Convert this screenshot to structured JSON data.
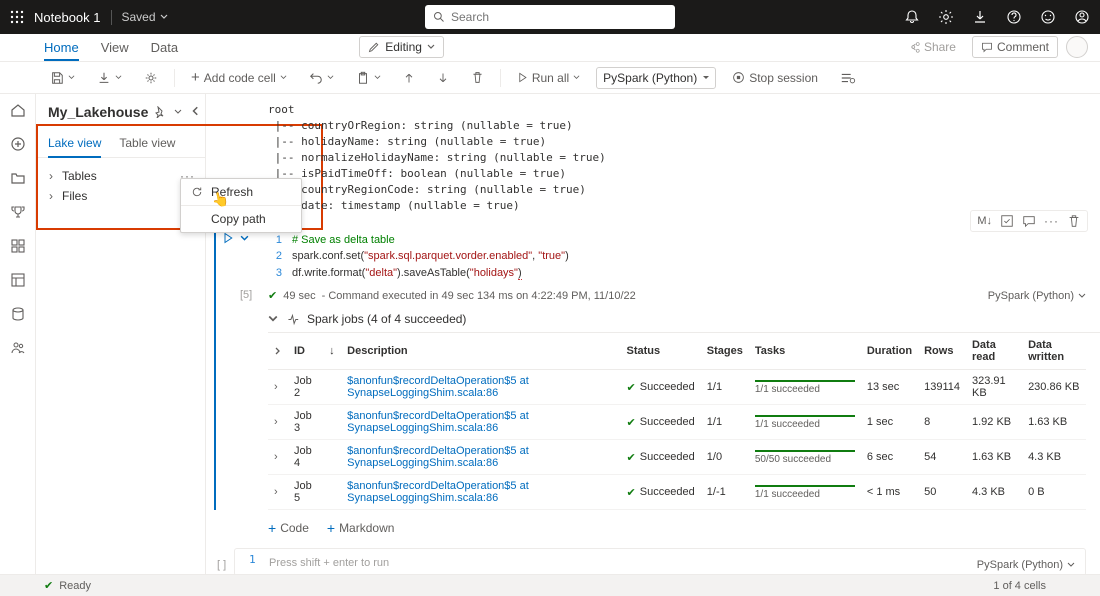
{
  "top": {
    "notebook_name": "Notebook 1",
    "saved_label": "Saved",
    "search_placeholder": "Search"
  },
  "ribbon": {
    "home": "Home",
    "view": "View",
    "data": "Data",
    "editing": "Editing",
    "share": "Share",
    "comment": "Comment"
  },
  "toolbar": {
    "add_code": "Add code cell",
    "run_all": "Run all",
    "kernel": "PySpark (Python)",
    "stop": "Stop session"
  },
  "side": {
    "title": "My_Lakehouse",
    "tabs": {
      "lake": "Lake view",
      "table": "Table view"
    },
    "tree": {
      "tables": "Tables",
      "files": "Files"
    },
    "ctx": {
      "refresh": "Refresh",
      "copy": "Copy path"
    }
  },
  "schema_output": "root\n |-- countryOrRegion: string (nullable = true)\n |-- holidayName: string (nullable = true)\n |-- normalizeHolidayName: string (nullable = true)\n |-- isPaidTimeOff: boolean (nullable = true)\n |-- countryRegionCode: string (nullable = true)\n |-- date: timestamp (nullable = true)",
  "cell": {
    "exec_n": "[5]",
    "code": {
      "l1_comment": "# Save as delta table",
      "l2a": "spark.conf.set(",
      "l2s1": "\"spark.sql.parquet.vorder.enabled\"",
      "l2c": ", ",
      "l2s2": "\"true\"",
      "l2b": ")",
      "l3a": "df.write.format(",
      "l3s1": "\"delta\"",
      "l3b": ").saveAsTable(",
      "l3s2": "\"holidays\"",
      "l3c": ")"
    },
    "status_time": "49 sec",
    "status_text": "- Command executed in 49 sec 134 ms  on 4:22:49 PM, 11/10/22",
    "kernel": "PySpark (Python)",
    "toolbar": {
      "md": "M↓"
    }
  },
  "spark": {
    "header": "Spark jobs (4 of 4 succeeded)",
    "cols": {
      "id": "ID",
      "desc": "Description",
      "status": "Status",
      "stages": "Stages",
      "tasks": "Tasks",
      "dur": "Duration",
      "rows": "Rows",
      "read": "Data read",
      "write": "Data written"
    },
    "desc_link": "$anonfun$recordDeltaOperation$5 at SynapseLoggingShim.scala:86",
    "status_ok": "Succeeded",
    "rows": [
      {
        "id": "Job 2",
        "stages": "1/1",
        "tasks": "1/1 succeeded",
        "dur": "13 sec",
        "rows": "139114",
        "read": "323.91 KB",
        "write": "230.86 KB"
      },
      {
        "id": "Job 3",
        "stages": "1/1",
        "tasks": "1/1 succeeded",
        "dur": "1 sec",
        "rows": "8",
        "read": "1.92 KB",
        "write": "1.63 KB"
      },
      {
        "id": "Job 4",
        "stages": "1/0",
        "tasks": "50/50 succeeded",
        "dur": "6 sec",
        "rows": "54",
        "read": "1.63 KB",
        "write": "4.3 KB"
      },
      {
        "id": "Job 5",
        "stages": "1/-1",
        "tasks": "1/1 succeeded",
        "dur": "< 1 ms",
        "rows": "50",
        "read": "4.3 KB",
        "write": "0 B"
      }
    ]
  },
  "add": {
    "code": "Code",
    "md": "Markdown"
  },
  "empty": {
    "ln": "1",
    "hint": "Press shift + enter to run",
    "kernel": "PySpark (Python)"
  },
  "status": {
    "ready": "Ready",
    "cells": "1 of 4 cells"
  },
  "colors": {
    "accent": "#006cbe",
    "success": "#107c10"
  }
}
